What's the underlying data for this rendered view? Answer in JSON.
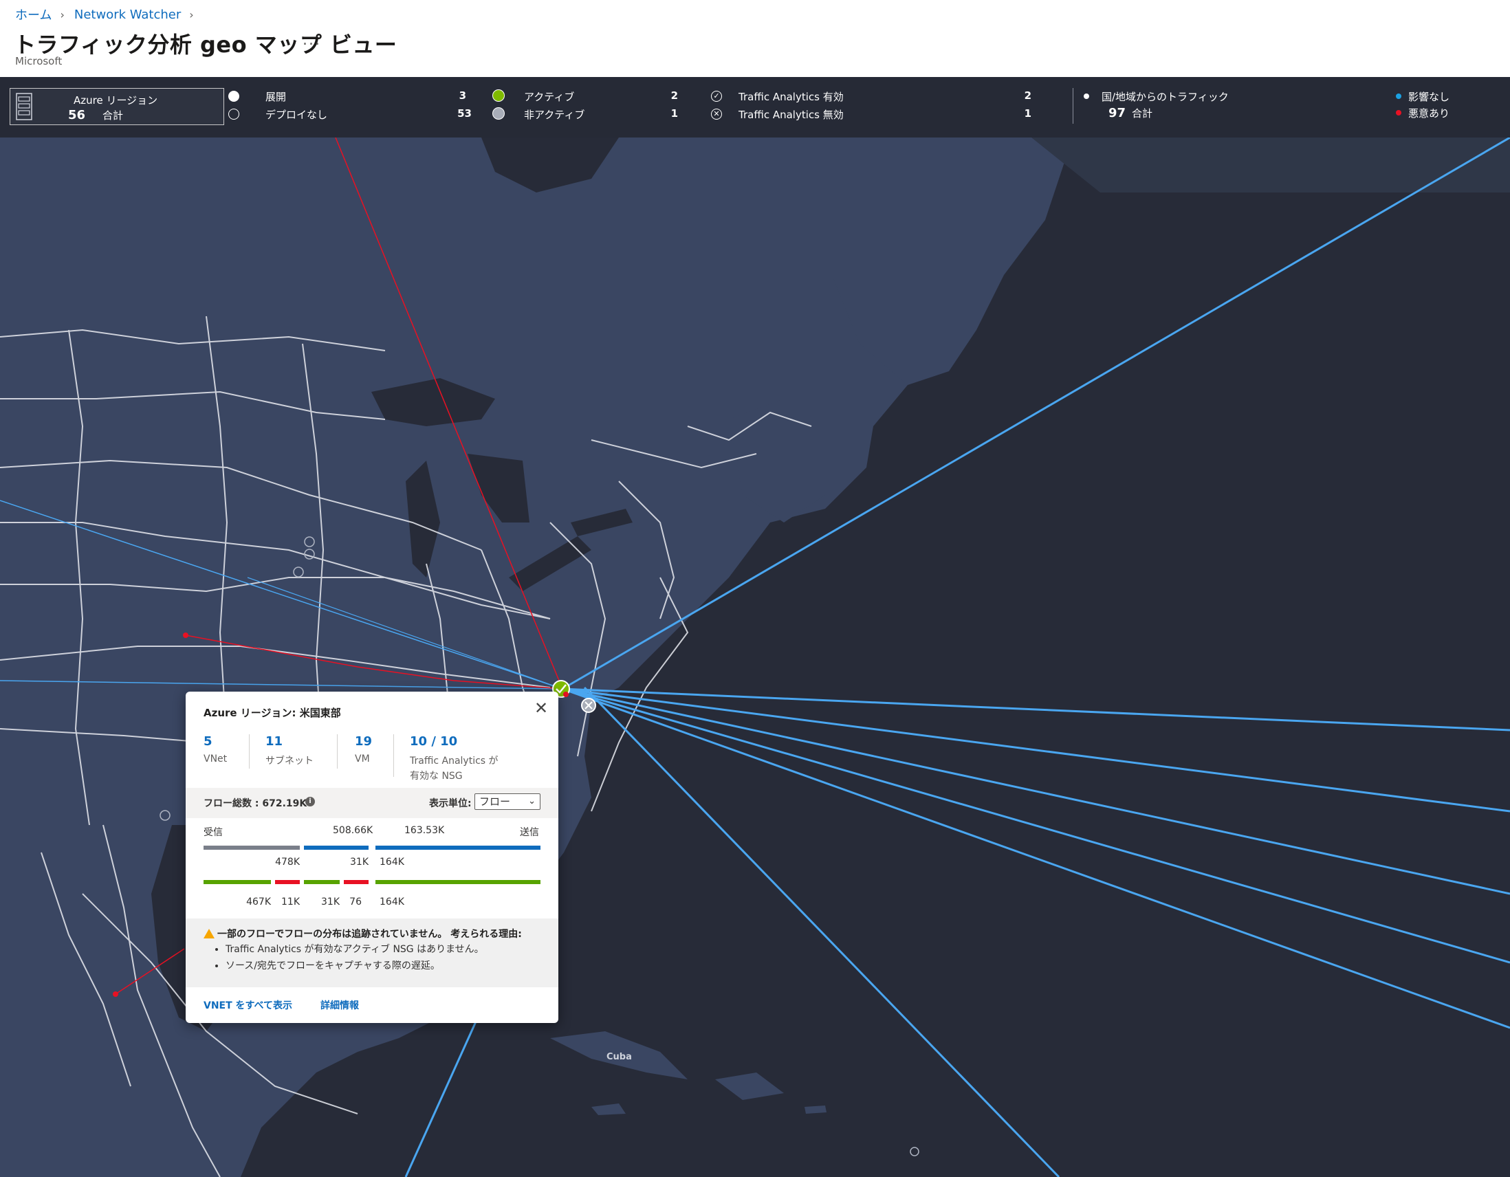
{
  "header": {
    "breadcrumb": [
      "ホーム",
      "Network Watcher"
    ],
    "title": "トラフィック分析 geo マップ ビュー",
    "more": "...",
    "subtitle": "Microsoft"
  },
  "legend": {
    "region_box": {
      "title": "Azure リージョン",
      "total": "56",
      "total_label": "合計"
    },
    "deployment": [
      {
        "label": "展開",
        "count": "3"
      },
      {
        "label": "デプロイなし",
        "count": "53"
      }
    ],
    "activity": [
      {
        "label": "アクティブ",
        "count": "2",
        "color": "#7fba00"
      },
      {
        "label": "非アクティブ",
        "count": "1",
        "color": "#a8adb8"
      }
    ],
    "analytics": [
      {
        "label": "Traffic Analytics 有効",
        "count": "2",
        "icon": "check-circle-icon"
      },
      {
        "label": "Traffic Analytics 無効",
        "count": "1",
        "icon": "x-circle-icon"
      }
    ],
    "country_traffic": {
      "title": "国/地域からのトラフィック",
      "total": "97",
      "total_label": "合計"
    },
    "traffic_kind": [
      {
        "label": "影響なし",
        "color": "#1ba1e2"
      },
      {
        "label": "悪意あり",
        "color": "#e81123"
      }
    ]
  },
  "map": {
    "labels": {
      "cuba": "Cuba"
    }
  },
  "popup": {
    "title": "Azure リージョン: 米国東部",
    "close": "✕",
    "stats": [
      {
        "value": "5",
        "label": "VNet"
      },
      {
        "value": "11",
        "label": "サブネット"
      },
      {
        "value": "19",
        "label": "VM"
      },
      {
        "value": "10 / 10",
        "label_line1": "Traffic Analytics が",
        "label_line2": "有効な NSG"
      }
    ],
    "total_flows": "フロー総数 : 672.19K",
    "info_icon": "i",
    "unit_label": "表示単位:",
    "unit_value": "フロー",
    "inbound_label": "受信",
    "outbound_label": "送信",
    "inbound_total": "508.66K",
    "outbound_total": "163.53K",
    "row1_values": [
      "478K",
      "31K",
      "164K"
    ],
    "row2_values": [
      "467K",
      "11K",
      "31K",
      "76",
      "164K"
    ],
    "colors": {
      "gray": "#7a7f8a",
      "blue": "#0f6cbd",
      "green": "#57a300",
      "red": "#e81123"
    },
    "warning_title": "一部のフローでフローの分布は追跡されていません。 考えられる理由:",
    "warning_items": [
      "Traffic Analytics が有効なアクティブ NSG はありません。",
      "ソース/宛先でフローをキャプチャする際の遅延。"
    ],
    "links": {
      "all_vnets": "VNET をすべて表示",
      "details": "詳細情報"
    }
  }
}
